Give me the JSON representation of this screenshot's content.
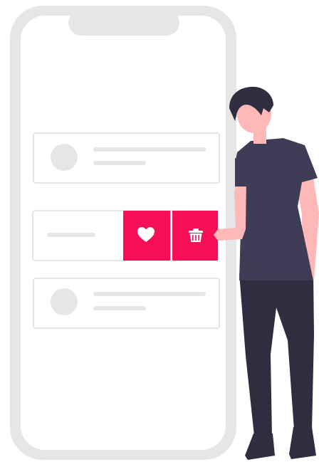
{
  "colors": {
    "phone_frame": "#e6e6e6",
    "screen": "#ffffff",
    "card_border": "#e6e6e6",
    "placeholder": "#e6e6e6",
    "action_accent": "#f50f56",
    "shirt": "#3f3d56",
    "pants": "#2f2e41",
    "hair": "#2f2e41",
    "skin": "#ffb8b8"
  },
  "list_items": [
    {
      "kind": "avatar-row",
      "has_avatar": true
    },
    {
      "kind": "swiped-row",
      "has_avatar": false,
      "actions": [
        "heart-icon",
        "trash-icon"
      ]
    },
    {
      "kind": "avatar-row",
      "has_avatar": true
    }
  ],
  "actions": {
    "favorite_icon": "heart-icon",
    "delete_icon": "trash-icon"
  }
}
